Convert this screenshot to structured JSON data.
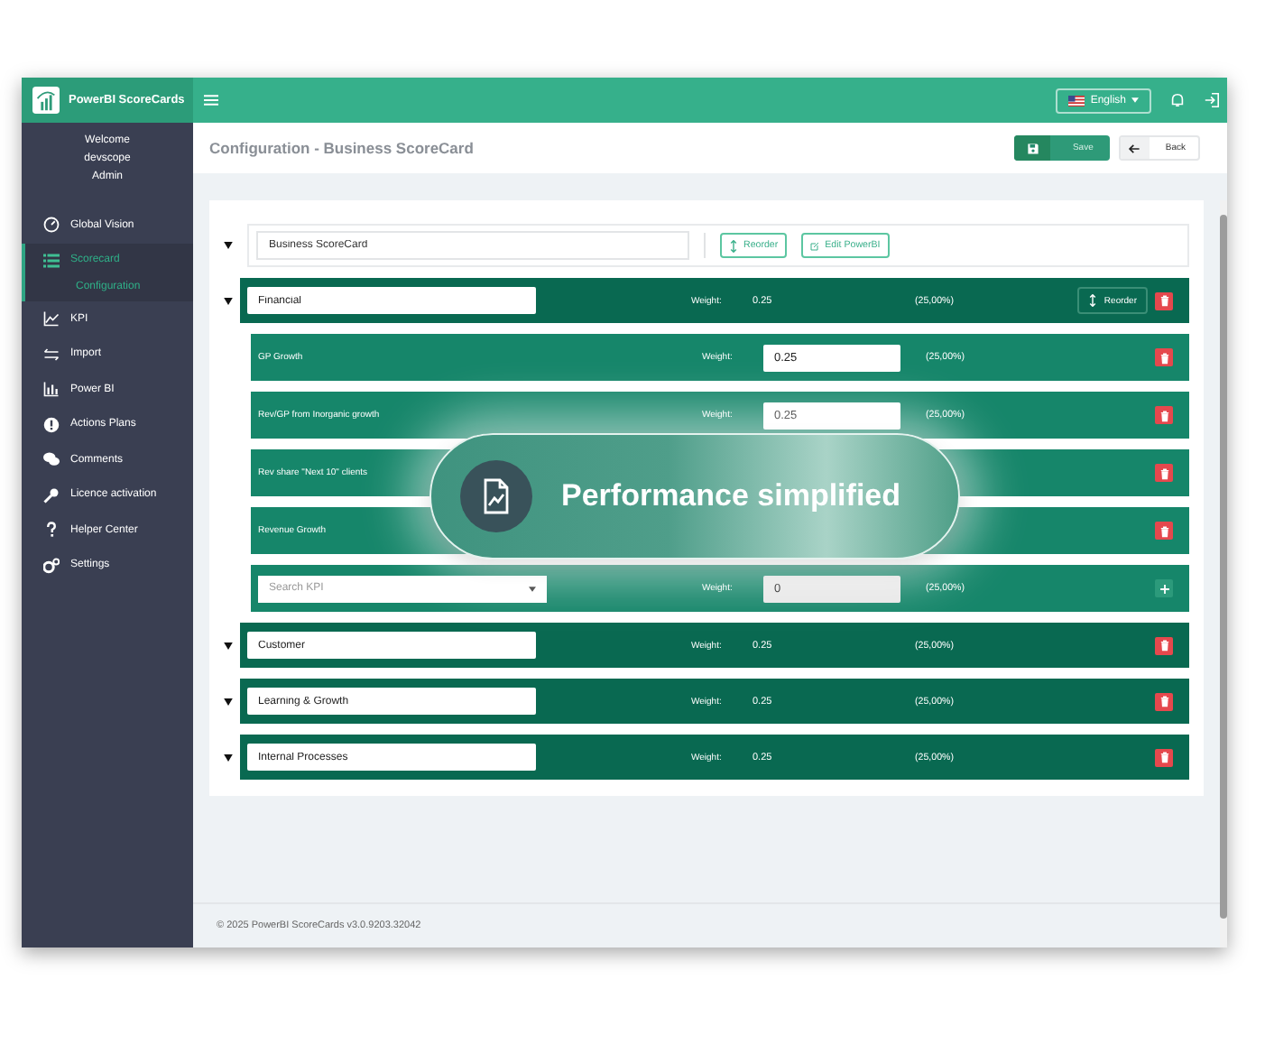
{
  "app": {
    "name": "PowerBI ScoreCards",
    "language": "English"
  },
  "user": {
    "lines": [
      "Welcome",
      "devscope",
      "Admin"
    ]
  },
  "sidebar": {
    "items": [
      {
        "label": "Global Vision",
        "selected": false
      },
      {
        "label": "Scorecard",
        "selected": true,
        "children": [
          {
            "label": "Configuration",
            "selected": true
          }
        ]
      },
      {
        "label": "KPI",
        "selected": false
      },
      {
        "label": "Import",
        "selected": false
      },
      {
        "label": "Power BI",
        "selected": false
      },
      {
        "label": "Actions Plans",
        "selected": false
      },
      {
        "label": "Comments",
        "selected": false
      },
      {
        "label": "Licence activation",
        "selected": false
      },
      {
        "label": "Helper Center",
        "selected": false
      },
      {
        "label": "Settings",
        "selected": false
      }
    ]
  },
  "page": {
    "title": "Configuration - Business ScoreCard",
    "save": "Save",
    "back": "Back"
  },
  "scorecard": {
    "name": "Business ScoreCard",
    "reorder": "Reorder",
    "edit": "Edit PowerBI",
    "groups": [
      {
        "name": "Financial",
        "weight_label": "Weight:",
        "weight": "0.25",
        "share": "(25,00%)",
        "reorder": "Reorder",
        "kpis": [
          {
            "kind": "kpi",
            "name": "GP Growth",
            "weight_label": "Weight:",
            "weight": "0.25",
            "share": "(25,00%)"
          },
          {
            "kind": "kpi",
            "name": "Rev/GP from Inorganic growth",
            "weight_label": "Weight:",
            "weight": "0.25",
            "share": "(25,00%)"
          },
          {
            "kind": "kpi",
            "name": "Rev share \"Next 10\" clients"
          },
          {
            "kind": "kpi",
            "name": "Revenue Growth"
          },
          {
            "kind": "new",
            "placeholder": "Search KPI",
            "weight_label": "Weight:",
            "weight": "0",
            "share": "(25,00%)"
          }
        ]
      },
      {
        "name": "Customer",
        "weight_label": "Weight:",
        "weight": "0.25",
        "share": "(25,00%)"
      },
      {
        "name": "Learning & Growth",
        "weight_label": "Weight:",
        "weight": "0.25",
        "share": "(25,00%)"
      },
      {
        "name": "Internal Processes",
        "weight_label": "Weight:",
        "weight": "0.25",
        "share": "(25,00%)"
      }
    ]
  },
  "footer": "©  2025 PowerBI ScoreCards v3.0.9203.32042",
  "banner": {
    "text": "Performance simplified"
  }
}
